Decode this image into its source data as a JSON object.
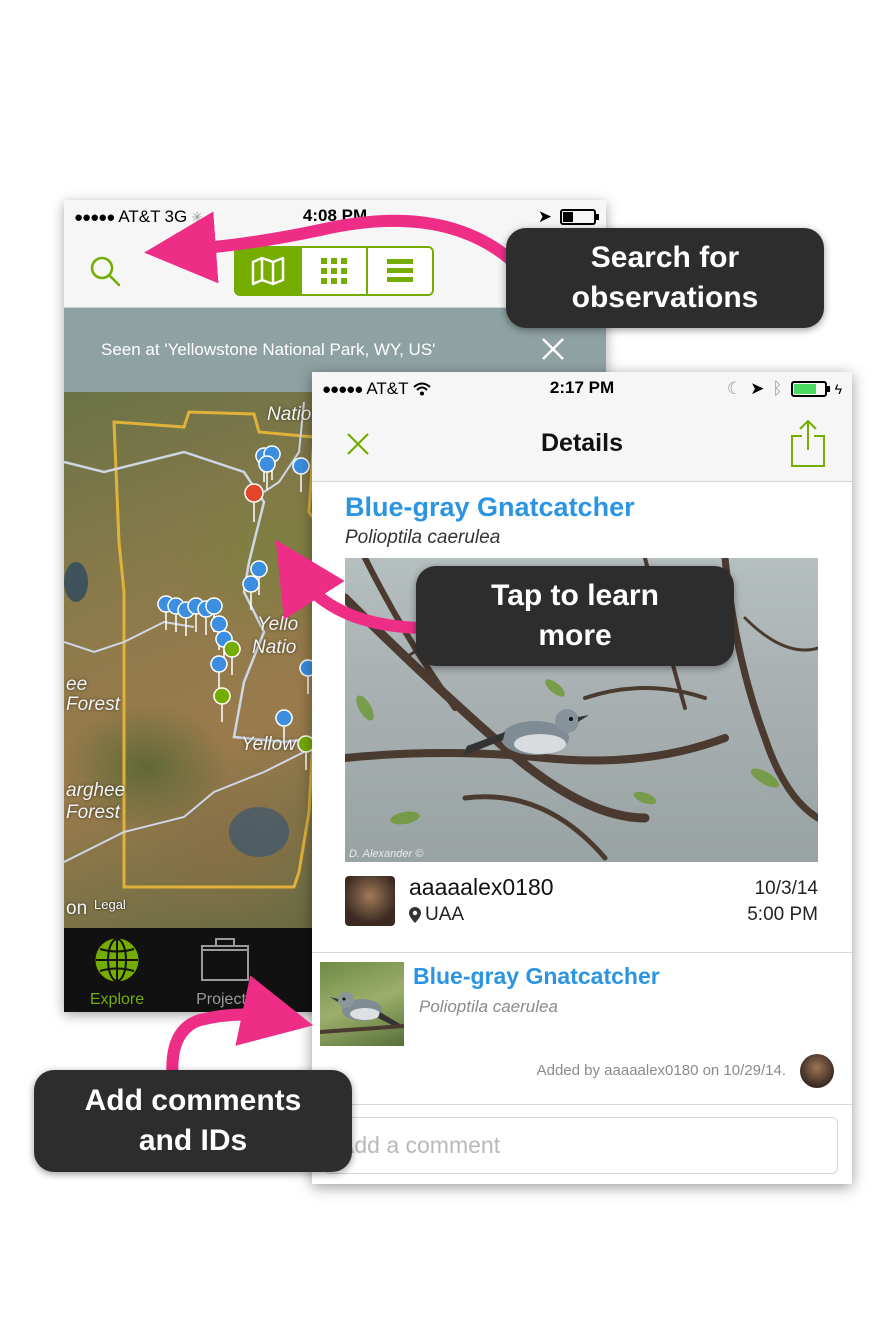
{
  "back_screen": {
    "status": {
      "carrier": "AT&T",
      "network": "3G",
      "time": "4:08 PM"
    },
    "filter_banner": "Seen at 'Yellowstone National Park, WY, US'",
    "map_labels": [
      "Natio",
      "Yello",
      "Natio",
      "Yellow",
      "ee",
      "Forest",
      "arghee",
      "Forest",
      "on"
    ],
    "map_legal": "Legal",
    "tabs": [
      {
        "label": "Explore",
        "color": "#74ac00",
        "icon": "globe-icon"
      },
      {
        "label": "Projects",
        "color": "#9a9a9a",
        "icon": "briefcase-icon"
      }
    ]
  },
  "front_screen": {
    "status": {
      "carrier": "AT&T",
      "time": "2:17 PM"
    },
    "nav_title": "Details",
    "observation": {
      "common_name": "Blue-gray Gnatcatcher",
      "scientific_name": "Polioptila caerulea",
      "photo_credit": "D. Alexander ©",
      "user": "aaaaalex0180",
      "place": "UAA",
      "date": "10/3/14",
      "time": "5:00 PM"
    },
    "identification": {
      "common_name": "Blue-gray Gnatcatcher",
      "scientific_name": "Polioptila caerulea",
      "added_by": "Added by aaaaalex0180 on 10/29/14."
    },
    "comment_placeholder": "Add a comment"
  },
  "callouts": {
    "search": [
      "Search for",
      "observations"
    ],
    "learn": [
      "Tap to learn",
      "more"
    ],
    "comments": [
      "Add comments",
      "and IDs"
    ]
  },
  "colors": {
    "accent_green": "#74ac00",
    "link_blue": "#2b95e3",
    "callout_arrow": "#ee2d86",
    "callout_bg": "#2d2d2d"
  }
}
